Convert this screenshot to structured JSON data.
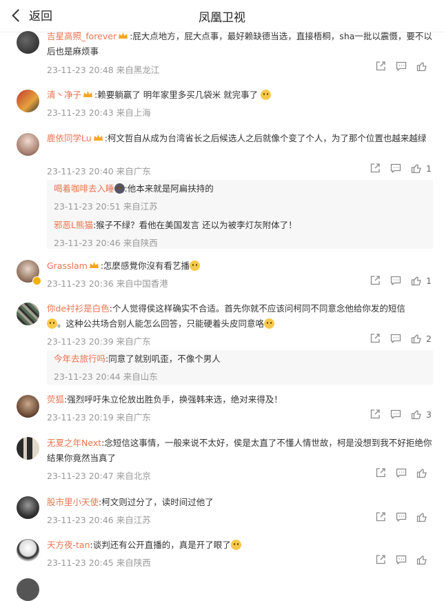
{
  "header": {
    "back_label": "返回",
    "title": "凤凰卫视"
  },
  "comments": [
    {
      "name": "吉星高照_forever",
      "text": ":屁大点地方，屁大点事，最好赖缺德当选，直接梧桐，sha一批以震慑，要不以后也是麻烦事",
      "time": "23-11-23 20:48 来自黑龙江",
      "likes": "",
      "vip": true
    },
    {
      "name": "清丶净子",
      "text": ":赖要躺赢了 明年家里多买几袋米 就完事了",
      "time": "23-11-23 20:43 来自上海",
      "likes": "",
      "vip": true
    },
    {
      "name": "鹿依同学Lu",
      "text": ":柯文哲自从成为台湾省长之后候选人之后就像个变了个人，为了那个位置也越来越绿",
      "time": "23-11-23 20:40 来自广东",
      "likes": "1",
      "vip": true,
      "replies": [
        {
          "name": "喝着咖啡去入睡",
          "text": ":他本来就是阿扁扶持的",
          "time": "23-11-23 20:51 来自江苏"
        },
        {
          "name": "邪恶L熊猫",
          "text": ":猴子不绿？看他在美国发言 还以为被李灯灰附体了！",
          "time": "23-11-23 20:46 来自陕西"
        }
      ]
    },
    {
      "name": "Grasslam",
      "text": ":怎麼感覺你沒有看艺播",
      "time": "23-11-23 20:36 来自中国香港",
      "likes": "1",
      "vip": true
    },
    {
      "name": "你de衬衫是白色",
      "text": ":个人觉得侯这样确实不合适。首先你就不应该问柯同不同意念他给你发的短信",
      "text2": "。这种公共场合别人能怎么回答，只能硬着头皮同意咯",
      "time": "23-11-23 20:39 来自广东",
      "likes": "2",
      "replies": [
        {
          "name": "今年去旅行吗",
          "text": ":同意了就别叽歪，不像个男人",
          "time": "23-11-23 20:44 来自山东"
        }
      ]
    },
    {
      "name": "荧狐",
      "text": ":强烈呼吁朱立伦放出胜负手，换强韩来选，绝对来得及！",
      "time": "23-11-23 20:19 来自广东",
      "likes": "3"
    },
    {
      "name": "无夏之年Next",
      "text": ":念短信这事情，一般来说不太好，侯是太直了不懂人情世故，柯是没想到我不好拒绝你结果你竟然当真了",
      "time": "23-11-23 20:47 来自北京",
      "likes": ""
    },
    {
      "name": "股市里小天使",
      "text": ":柯文则过分了，读时间过他了",
      "time": "23-11-23 20:46 来自江苏",
      "likes": ""
    },
    {
      "name": "天方夜-tan",
      "text": ":谈判还有公开直播的，真是开了眼了",
      "time": "23-11-23 20:45 来自陕西",
      "likes": ""
    }
  ],
  "colors": {
    "accent": "#eb7350",
    "meta": "#999999"
  }
}
